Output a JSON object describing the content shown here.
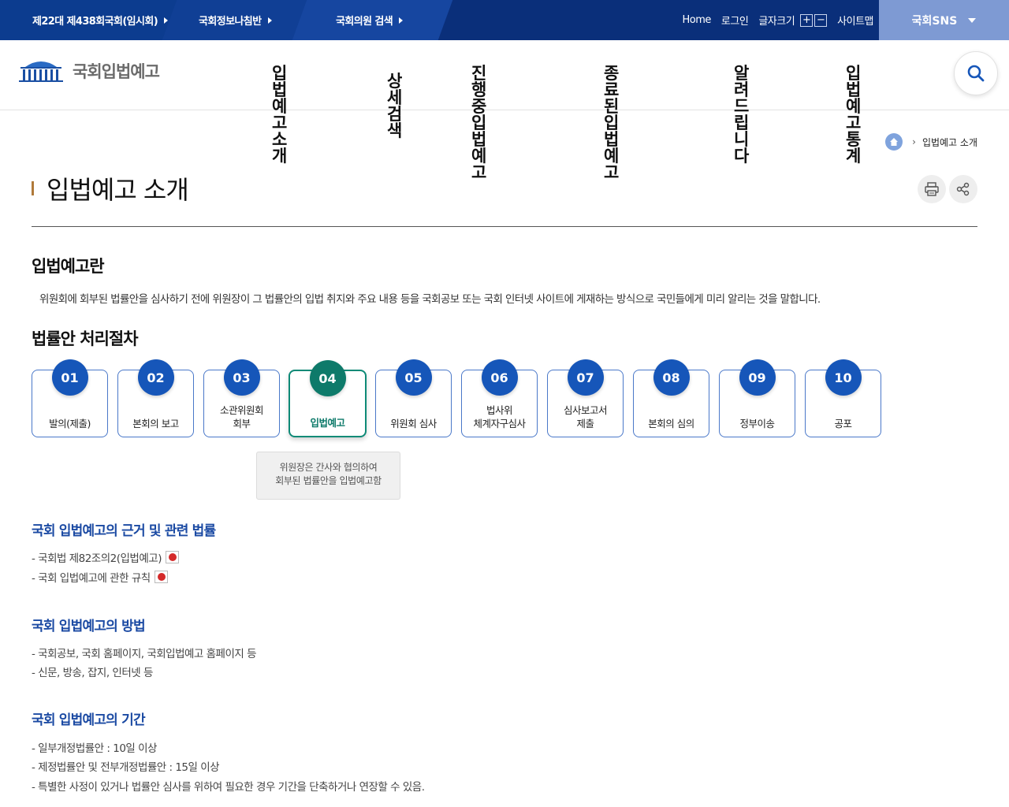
{
  "topbar": {
    "links": [
      {
        "label": "제22대 제438회국회(임시회)"
      },
      {
        "label": "국회정보나침반"
      },
      {
        "label": "국회의원 검색"
      }
    ],
    "util": {
      "home": "Home",
      "login": "로그인",
      "fontsize": "글자크기",
      "sitemap": "사이트맵"
    },
    "sns": "국회SNS"
  },
  "header": {
    "logo_text": "국회입법예고",
    "gnb": [
      {
        "line1": "입법예고 소",
        "line2": "개"
      },
      {
        "line1": "상세검색",
        "line2": ""
      },
      {
        "line1": "진행 중 입법예",
        "line2": "고"
      },
      {
        "line1": "종료된 입법예",
        "line2": "고"
      },
      {
        "line1": "알려드립니",
        "line2": "다"
      },
      {
        "line1": "입법예고 통",
        "line2": "계"
      }
    ]
  },
  "breadcrumb": {
    "current": "입법예고 소개"
  },
  "page": {
    "title": "입법예고 소개"
  },
  "sections": {
    "intro": {
      "heading": "입법예고란",
      "text": "위원회에 회부된 법률안을 심사하기 전에 위원장이 그 법률안의 입법 취지와 주요 내용 등을 국회공보 또는 국회 인터넷 사이트에 게재하는 방식으로 국민들에게 미리 알리는 것을 말합니다."
    },
    "process": {
      "heading": "법률안 처리절차",
      "steps": [
        {
          "num": "01",
          "line1": "발의(제출)",
          "line2": ""
        },
        {
          "num": "02",
          "line1": "본회의 보고",
          "line2": ""
        },
        {
          "num": "03",
          "line1": "소관위원회",
          "line2": "회부"
        },
        {
          "num": "04",
          "line1": "입법예고",
          "line2": ""
        },
        {
          "num": "05",
          "line1": "위원회 심사",
          "line2": ""
        },
        {
          "num": "06",
          "line1": "법사위",
          "line2": "체계자구심사"
        },
        {
          "num": "07",
          "line1": "심사보고서",
          "line2": "제출"
        },
        {
          "num": "08",
          "line1": "본회의 심의",
          "line2": ""
        },
        {
          "num": "09",
          "line1": "정부이송",
          "line2": ""
        },
        {
          "num": "10",
          "line1": "공포",
          "line2": ""
        }
      ],
      "active_step": "04",
      "tooltip": {
        "line1": "위원장은 간사와 협의하여",
        "line2": "회부된 법률안을 입법예고함"
      }
    },
    "basis": {
      "heading": "국회 입법예고의 근거 및 관련 법률",
      "items": [
        "- 국회법 제82조의2(입법예고)",
        "- 국회 입법예고에 관한 규칙"
      ]
    },
    "method": {
      "heading": "국회 입법예고의 방법",
      "items": [
        "- 국회공보, 국회 홈페이지, 국회입법예고 홈페이지 등",
        "- 신문, 방송, 잡지, 인터넷 등"
      ]
    },
    "period": {
      "heading": "국회 입법예고의 기간",
      "items": [
        "- 일부개정법률안 : 10일 이상",
        "- 제정법률안 및 전부개정법률안 : 15일 이상",
        "- 특별한 사정이 있거나 법률안 심사를 위하여 필요한 경우 기간을 단축하거나 연장할 수 있음."
      ]
    }
  },
  "colors": {
    "primary": "#1656b9",
    "active": "#0e7a6a",
    "topbar": "#0a2f7a",
    "heading_blue": "#1b4aa3"
  }
}
